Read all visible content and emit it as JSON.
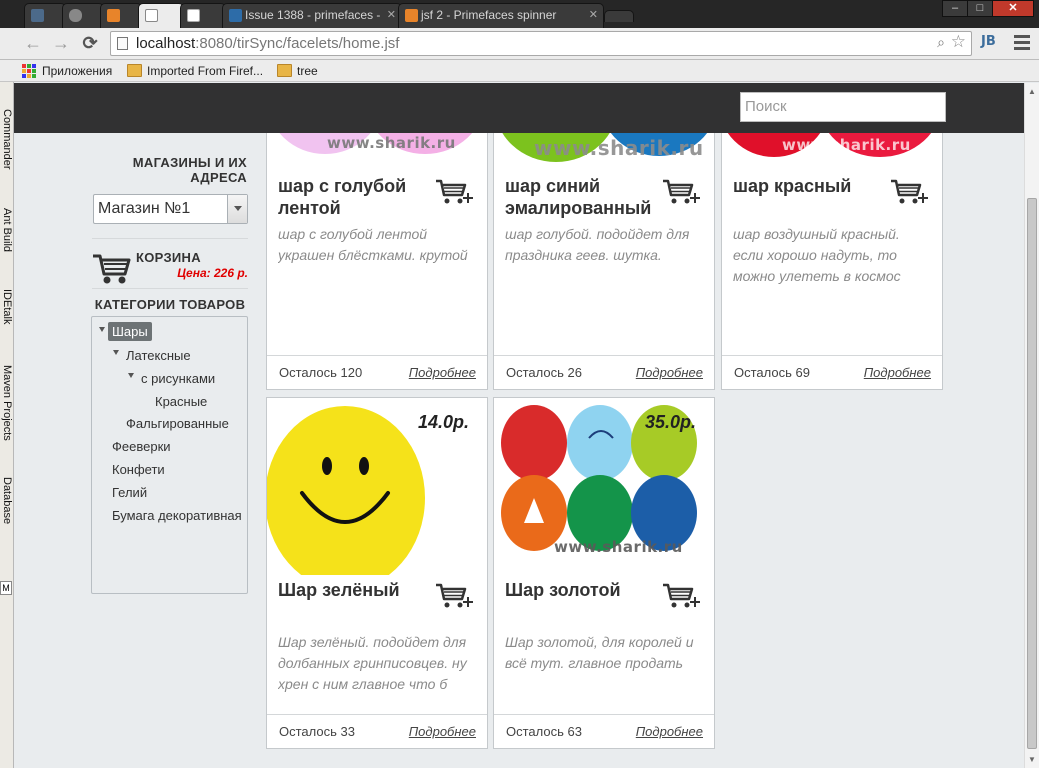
{
  "browser": {
    "tabs": [
      {
        "label": ""
      },
      {
        "label": ""
      },
      {
        "label": ""
      },
      {
        "label": ""
      },
      {
        "label": ""
      },
      {
        "label": "Issue 1388 - primefaces - "
      },
      {
        "label": "jsf 2 - Primefaces spinner"
      },
      {
        "label": ""
      }
    ],
    "window_controls": {
      "minimize": "–",
      "maximize": "□",
      "close": "✕"
    },
    "url_host": "localhost",
    "url_rest": ":8080/tirSync/facelets/home.jsf",
    "extension_label": "JB",
    "bookmarks": [
      {
        "label": "Приложения",
        "icon": "apps-icon"
      },
      {
        "label": "Imported From Firef...",
        "icon": "folder-icon"
      },
      {
        "label": "tree",
        "icon": "folder-icon"
      }
    ]
  },
  "ide_panel": {
    "tabs": [
      "Commander",
      "Ant Build",
      "IDEtalk",
      "Maven Projects",
      "Database"
    ],
    "button": "M"
  },
  "site": {
    "search_placeholder": "Поиск",
    "stores_title": "МАГАЗИНЫ И ИХ АДРЕСА",
    "store_selected": "Магазин №1",
    "cart_title": "КОРЗИНА",
    "cart_price": "Цена: 226 р.",
    "categories_title": "КАТЕГОРИИ ТОВАРОВ",
    "categories": [
      {
        "label": "Шары",
        "expanded": true,
        "selected": true
      },
      {
        "label": "Латексные",
        "expanded": true
      },
      {
        "label": "с рисунками",
        "expanded": true
      },
      {
        "label": "Красные"
      },
      {
        "label": "Фальгированные"
      },
      {
        "label": "Фееверки"
      },
      {
        "label": "Конфети"
      },
      {
        "label": "Гелий"
      },
      {
        "label": "Бумага декоративная"
      }
    ],
    "watermark": "www.sharik.ru",
    "products": [
      {
        "name": "шар с голубой лентой",
        "desc": "шар с голубой лентой украшен блёстками. крутой",
        "stock": "Осталось 120",
        "more": "Подробнее",
        "price": "",
        "image": "pink-balloons-image"
      },
      {
        "name": "шар синий эмалированный",
        "desc": "шар голубой. подойдет для праздника геев. шутка.",
        "stock": "Осталось 26",
        "more": "Подробнее",
        "price": "",
        "image": "green-blue-balloons-image"
      },
      {
        "name": "шар красный",
        "desc": "шар воздушный красный. если хорошо надуть, то можно улететь в космос",
        "stock": "Осталось 69",
        "more": "Подробнее",
        "price": "",
        "image": "red-balloons-image"
      },
      {
        "name": "Шар зелёный",
        "desc": "Шар зелёный. подойдет для долбанных гринписовцев. ну хрен с ним главное что б",
        "stock": "Осталось 33",
        "more": "Подробнее",
        "price": "14.0р.",
        "image": "smiley-balloon-image"
      },
      {
        "name": "Шар золотой",
        "desc": "Шар золотой, для королей и всё тут. главное продать",
        "stock": "Осталось 63",
        "more": "Подробнее",
        "price": "35.0р.",
        "image": "colorful-balloons-image"
      }
    ]
  }
}
